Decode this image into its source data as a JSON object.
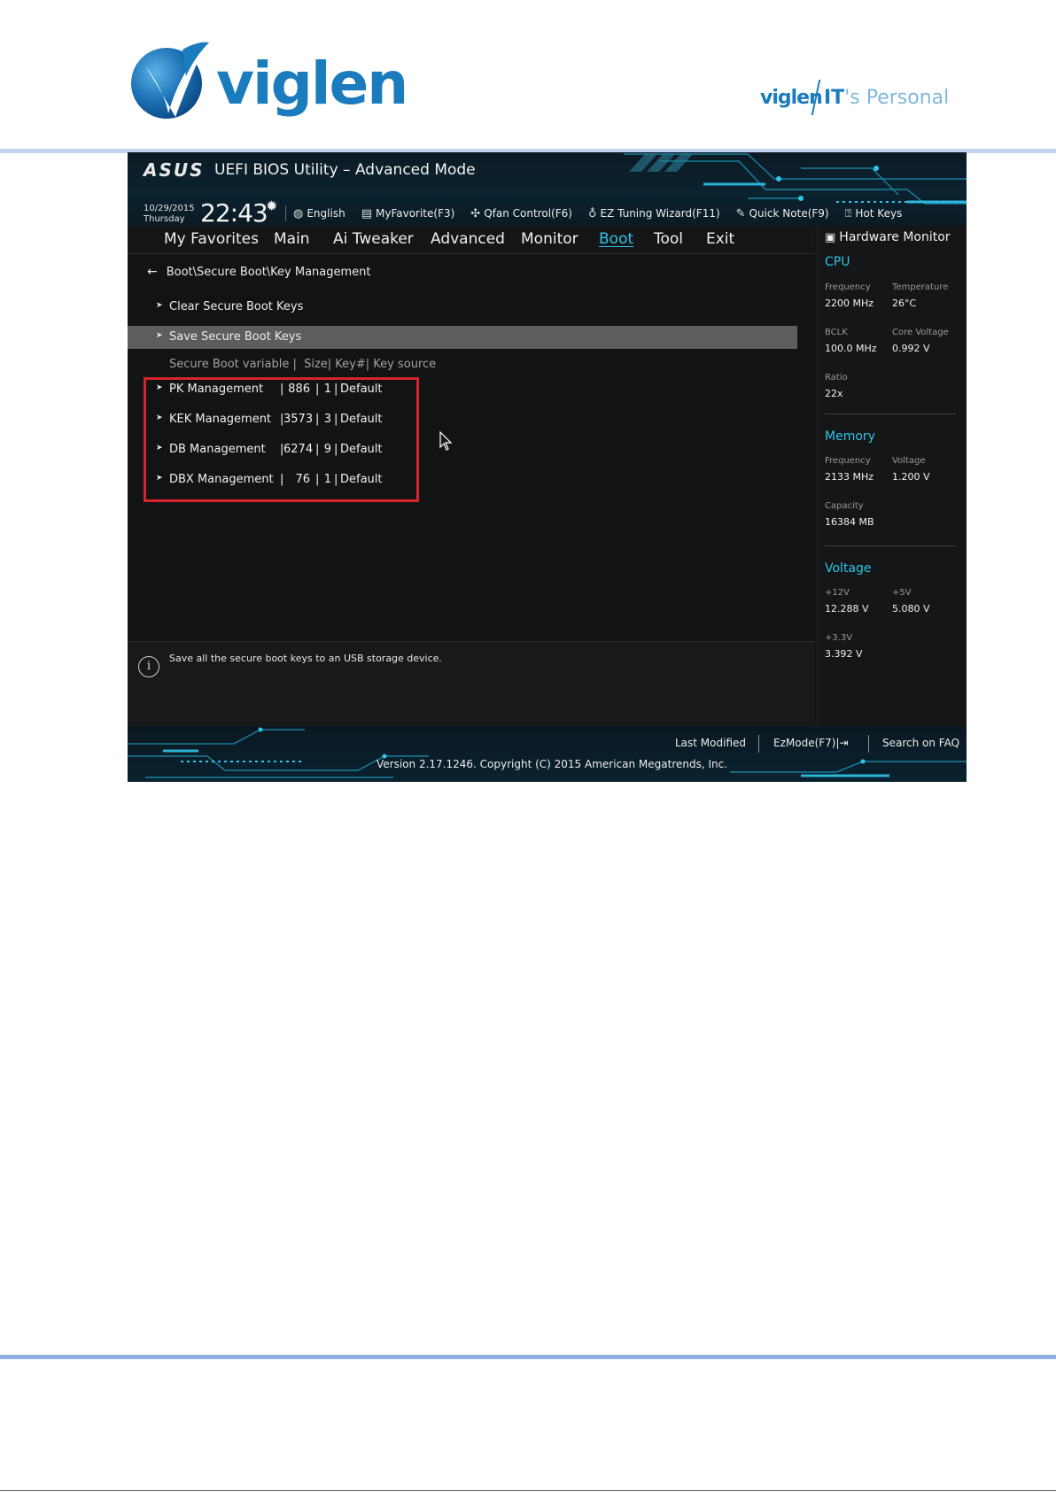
{
  "document": {
    "brand": "viglen",
    "tagline_brand": "viglen",
    "tagline_its": "IT",
    "tagline_rest": "'s Personal"
  },
  "bios": {
    "vendor": "ASUS",
    "title": "UEFI BIOS Utility – Advanced Mode",
    "date": "10/29/2015",
    "day": "Thursday",
    "time": "22:43",
    "toolbar": [
      {
        "icon": "globe-icon",
        "label": "English"
      },
      {
        "icon": "favorites-icon",
        "label": "MyFavorite(F3)"
      },
      {
        "icon": "fan-icon",
        "label": "Qfan Control(F6)"
      },
      {
        "icon": "bulb-icon",
        "label": "EZ Tuning Wizard(F11)"
      },
      {
        "icon": "note-icon",
        "label": "Quick Note(F9)"
      },
      {
        "icon": "question-icon",
        "label": "Hot Keys"
      }
    ],
    "tabs": [
      "My Favorites",
      "Main",
      "Ai Tweaker",
      "Advanced",
      "Monitor",
      "Boot",
      "Tool",
      "Exit"
    ],
    "active_tab": "Boot",
    "breadcrumb": "Boot\\Secure Boot\\Key Management",
    "menu": [
      "Clear Secure Boot Keys",
      "Save Secure Boot Keys"
    ],
    "selected_menu": "Save Secure Boot Keys",
    "column_header": "Secure Boot variable |  Size| Key#| Key source",
    "keys": [
      {
        "name": "PK Management",
        "size": "886",
        "key": "1",
        "source": "Default"
      },
      {
        "name": "KEK Management",
        "size": "3573",
        "key": "3",
        "source": "Default"
      },
      {
        "name": "DB Management",
        "size": "6274",
        "key": "9",
        "source": "Default"
      },
      {
        "name": "DBX Management",
        "size": "76",
        "key": "1",
        "source": "Default"
      }
    ],
    "help_text": "Save all the secure boot keys to an USB storage device.",
    "footer": {
      "last_modified": "Last Modified",
      "ezmode": "EzMode(F7)|",
      "search": "Search on FAQ",
      "copyright": "Version 2.17.1246. Copyright (C) 2015 American Megatrends, Inc."
    },
    "colors": {
      "accent": "#2fc4ea",
      "highlight_box": "#d8232a",
      "selected_row": "#5c5d5e"
    }
  },
  "hardware_monitor": {
    "title": "Hardware Monitor",
    "cpu": {
      "heading": "CPU",
      "frequency_label": "Frequency",
      "frequency": "2200 MHz",
      "temperature_label": "Temperature",
      "temperature": "26°C",
      "bclk_label": "BCLK",
      "bclk": "100.0 MHz",
      "core_voltage_label": "Core Voltage",
      "core_voltage": "0.992 V",
      "ratio_label": "Ratio",
      "ratio": "22x"
    },
    "memory": {
      "heading": "Memory",
      "frequency_label": "Frequency",
      "frequency": "2133 MHz",
      "voltage_label": "Voltage",
      "voltage": "1.200 V",
      "capacity_label": "Capacity",
      "capacity": "16384 MB"
    },
    "voltage": {
      "heading": "Voltage",
      "v12_label": "+12V",
      "v12": "12.288 V",
      "v5_label": "+5V",
      "v5": "5.080 V",
      "v33_label": "+3.3V",
      "v33": "3.392 V"
    }
  }
}
